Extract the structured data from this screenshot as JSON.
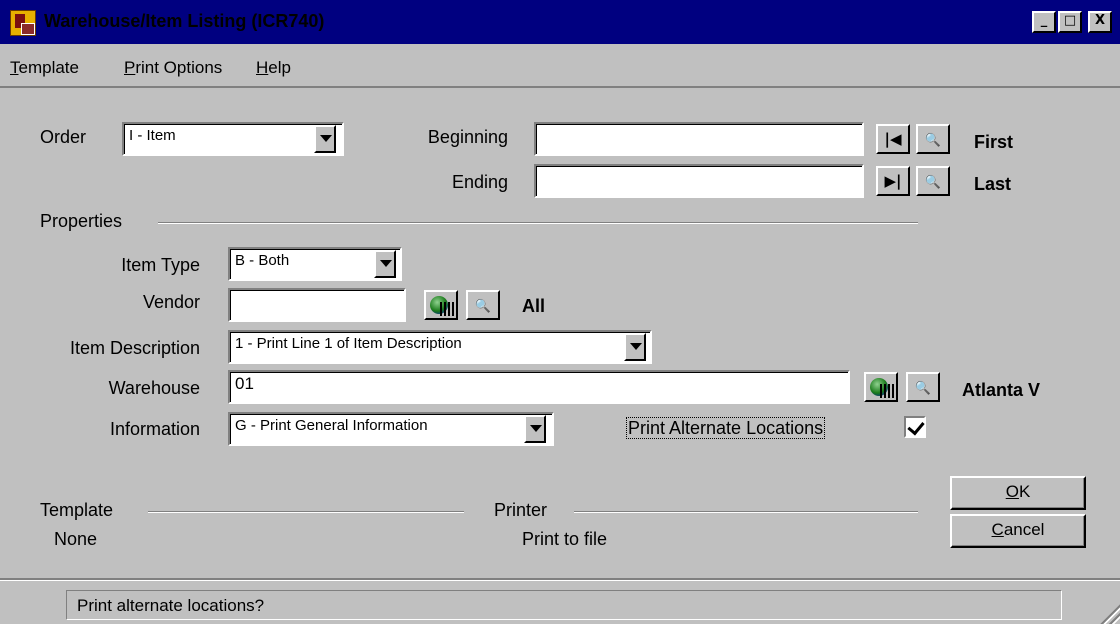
{
  "window": {
    "title": "Warehouse/Item Listing (ICR740)",
    "min_label": "_",
    "max_label": "□",
    "close_label": "X"
  },
  "menu": [
    {
      "accel": "T",
      "rest": "emplate"
    },
    {
      "accel": "P",
      "rest": "rint Options"
    },
    {
      "accel": "H",
      "rest": "elp"
    }
  ],
  "order": {
    "label": "Order",
    "value": "I - Item"
  },
  "range": {
    "beginning_label": "Beginning",
    "beginning_value": "",
    "ending_label": "Ending",
    "ending_value": "",
    "first_label": "First",
    "last_label": "Last",
    "first_btn": "|◀",
    "last_btn": "▶|",
    "lookup_btn": "🔍"
  },
  "properties": {
    "heading": "Properties",
    "item_type_label": "Item Type",
    "item_type_value": "B - Both",
    "vendor_label": "Vendor",
    "vendor_value": "",
    "vendor_desc": "All",
    "item_desc_label": "Item Description",
    "item_desc_value": "1 - Print Line 1 of Item Description",
    "warehouse_label": "Warehouse",
    "warehouse_value": "01",
    "warehouse_desc": "Atlanta V",
    "information_label": "Information",
    "information_value": "G - Print General Information",
    "alt_locations_label": "Print Alternate Locations",
    "alt_locations_checked": true
  },
  "template": {
    "heading": "Template",
    "value": "None"
  },
  "printer": {
    "heading": "Printer",
    "value": "Print to file"
  },
  "buttons": {
    "ok_accel": "O",
    "ok_rest": "K",
    "cancel_accel": "C",
    "cancel_rest": "ancel"
  },
  "status": {
    "text": "Print alternate locations?"
  },
  "icons": [
    "app-icon",
    "minimize-icon",
    "maximize-icon",
    "close-icon",
    "first-record-icon",
    "last-record-icon",
    "binoculars-icon",
    "globe-icon",
    "dropdown-arrow-icon",
    "checkmark-icon",
    "size-grip-icon"
  ]
}
